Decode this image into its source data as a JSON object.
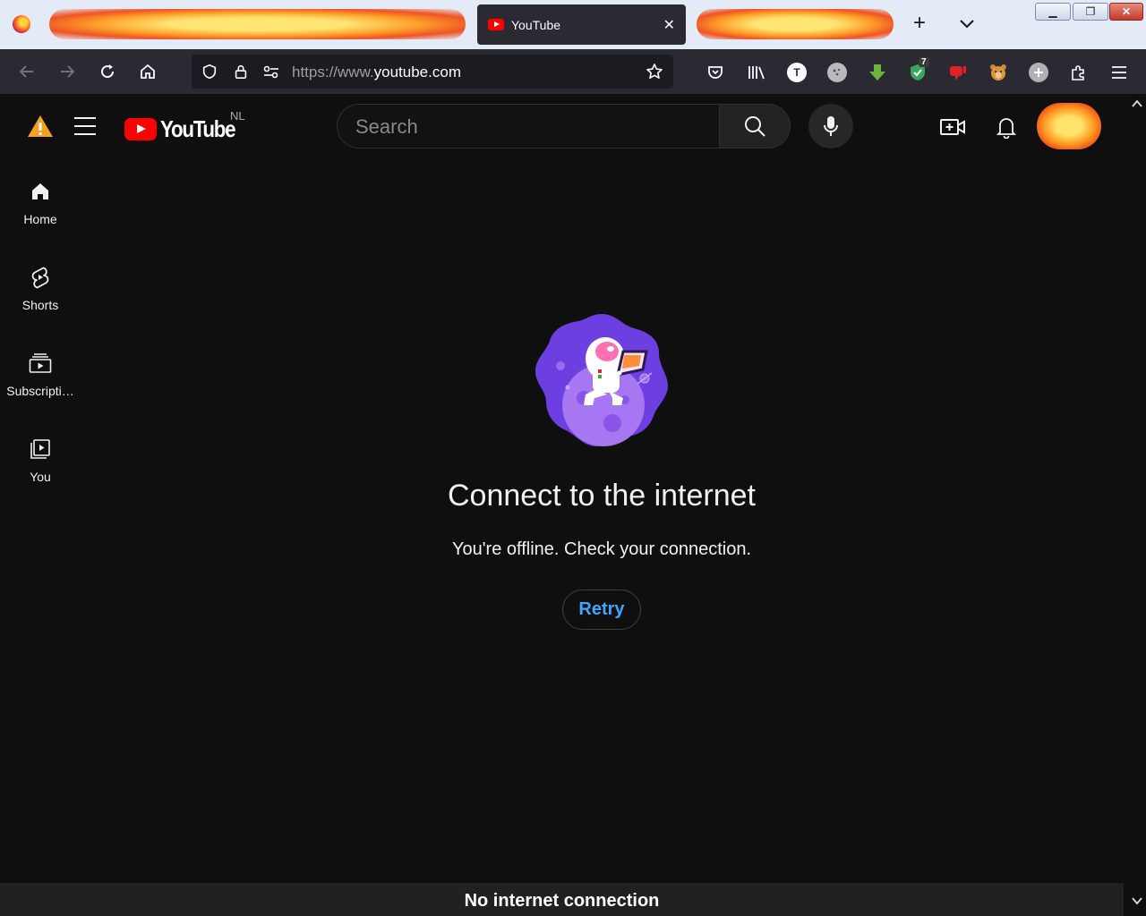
{
  "browser": {
    "tabs": [
      {
        "title": "",
        "state": "blurred"
      },
      {
        "title": "YouTube",
        "state": "active"
      },
      {
        "title": "",
        "state": "blurred"
      }
    ],
    "active_tab_title": "YouTube",
    "url_prefix": "https://www.",
    "url_domain": "youtube.com",
    "extension_badge": "7",
    "extension_letter": "T",
    "icons": [
      "back-icon",
      "forward-icon",
      "reload-icon",
      "home-icon",
      "shield-icon",
      "lock-icon",
      "permissions-icon",
      "bookmark-star-icon",
      "pocket-icon",
      "library-icon",
      "extensions-icon",
      "menu-icon"
    ]
  },
  "masthead": {
    "logo_text": "YouTube",
    "country_code": "NL",
    "search_placeholder": "Search"
  },
  "guide": {
    "items": [
      {
        "label": "Home",
        "icon": "home-icon"
      },
      {
        "label": "Shorts",
        "icon": "shorts-icon"
      },
      {
        "label": "Subscripti…",
        "icon": "subscriptions-icon"
      },
      {
        "label": "You",
        "icon": "you-library-icon"
      }
    ]
  },
  "offline": {
    "title": "Connect to the internet",
    "message": "You're offline. Check your connection.",
    "retry_label": "Retry"
  },
  "toast": {
    "message": "No internet connection"
  },
  "colors": {
    "background": "#0f0f0f",
    "accent_blue": "#3ea6ff",
    "youtube_red": "#ff0000",
    "browser_toolbar": "#2b2a33",
    "illustration_purple": "#7c3aed"
  }
}
